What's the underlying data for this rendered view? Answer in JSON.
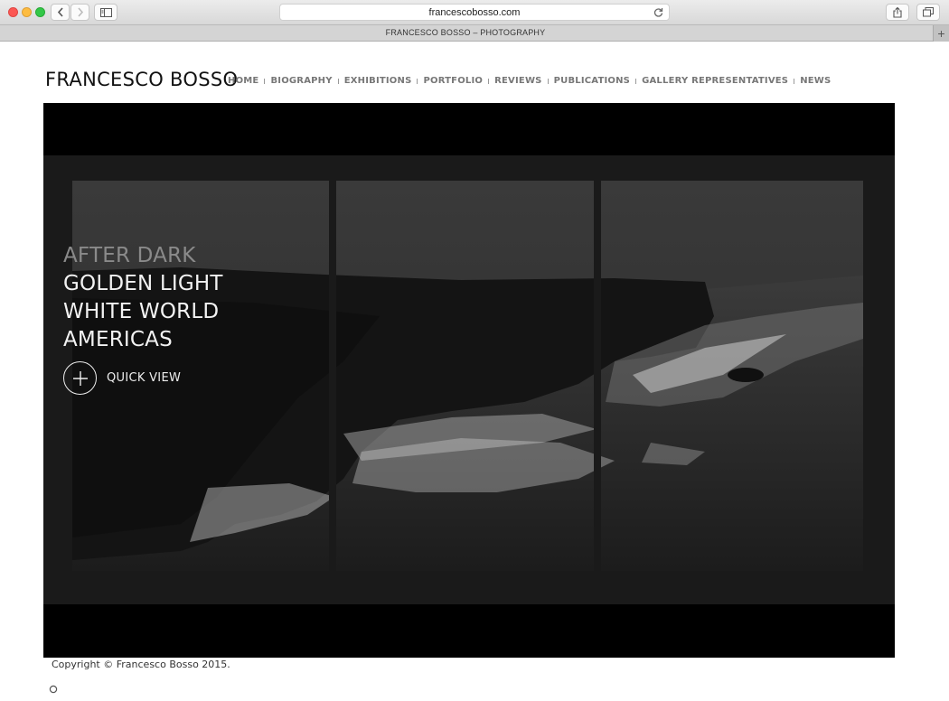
{
  "browser": {
    "url": "francescobosso.com",
    "tab_title": "FRANCESCO BOSSO – PHOTOGRAPHY",
    "new_tab_label": "+"
  },
  "site": {
    "title": "FRANCESCO BOSSO",
    "nav": [
      "HOME",
      "BIOGRAPHY",
      "EXHIBITIONS",
      "PORTFOLIO",
      "REVIEWS",
      "PUBLICATIONS",
      "GALLERY REPRESENTATIVES",
      "NEWS"
    ]
  },
  "slideshow": {
    "series": [
      {
        "label": "AFTER DARK",
        "active": false
      },
      {
        "label": "GOLDEN LIGHT",
        "active": true
      },
      {
        "label": "WHITE WORLD",
        "active": true
      },
      {
        "label": "AMERICAS",
        "active": true
      }
    ],
    "quick_view_label": "QUICK VIEW"
  },
  "footer": {
    "copyright": "Copyright © Francesco Bosso 2015."
  },
  "colors": {
    "stage": "#000000",
    "frame": "#1a1a1a",
    "nav_text": "#777777"
  }
}
